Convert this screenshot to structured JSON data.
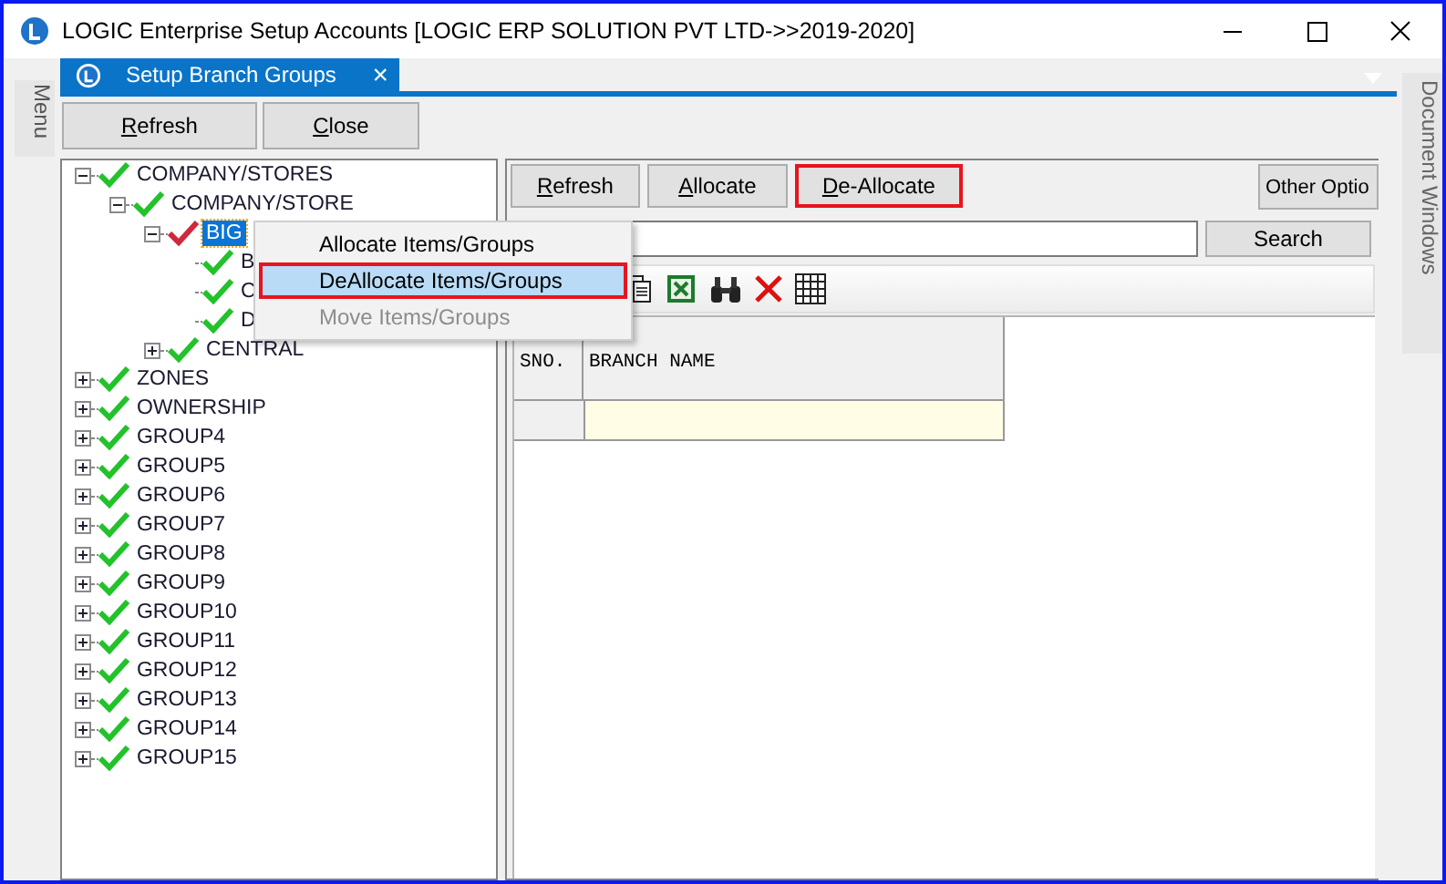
{
  "window": {
    "title": "LOGIC Enterprise Setup Accounts  [LOGIC ERP SOLUTION PVT LTD->>2019-2020]"
  },
  "side_left": {
    "label": "Menu"
  },
  "side_right": {
    "label": "Document Windows"
  },
  "tabs": [
    {
      "label": "Setup Branch Groups",
      "selected": true,
      "close": "×"
    }
  ],
  "top_buttons": [
    {
      "label": "Refresh"
    },
    {
      "label": "Close"
    }
  ],
  "tree": [
    {
      "label": "COMPANY/STORES",
      "expanded": true,
      "partial": false,
      "selected": false,
      "children": [
        {
          "label": "COMPANY/STORE",
          "expanded": true,
          "partial": false,
          "selected": false,
          "children": [
            {
              "label": "BIG",
              "expanded": true,
              "partial": true,
              "selected": true,
              "children": [
                {
                  "label": "B",
                  "partial": false,
                  "selected": false
                },
                {
                  "label": "C",
                  "partial": false,
                  "selected": false
                },
                {
                  "label": "D",
                  "partial": false,
                  "selected": false
                }
              ]
            },
            {
              "label": "CENTRAL",
              "expanded": false,
              "partial": false,
              "selected": false
            }
          ]
        }
      ]
    },
    {
      "label": "ZONES",
      "expanded": false,
      "partial": false,
      "selected": false
    },
    {
      "label": "OWNERSHIP",
      "expanded": false,
      "partial": false,
      "selected": false
    },
    {
      "label": "GROUP4",
      "expanded": false,
      "partial": false,
      "selected": false
    },
    {
      "label": "GROUP5",
      "expanded": false,
      "partial": false,
      "selected": false
    },
    {
      "label": "GROUP6",
      "expanded": false,
      "partial": false,
      "selected": false
    },
    {
      "label": "GROUP7",
      "expanded": false,
      "partial": false,
      "selected": false
    },
    {
      "label": "GROUP8",
      "expanded": false,
      "partial": false,
      "selected": false
    },
    {
      "label": "GROUP9",
      "expanded": false,
      "partial": false,
      "selected": false
    },
    {
      "label": "GROUP10",
      "expanded": false,
      "partial": false,
      "selected": false
    },
    {
      "label": "GROUP11",
      "expanded": false,
      "partial": false,
      "selected": false
    },
    {
      "label": "GROUP12",
      "expanded": false,
      "partial": false,
      "selected": false
    },
    {
      "label": "GROUP13",
      "expanded": false,
      "partial": false,
      "selected": false
    },
    {
      "label": "GROUP14",
      "expanded": false,
      "partial": false,
      "selected": false
    },
    {
      "label": "GROUP15",
      "expanded": false,
      "partial": false,
      "selected": false
    }
  ],
  "context_menu": [
    {
      "label": "Allocate Items/Groups",
      "selected": false,
      "disabled": false
    },
    {
      "label": "DeAllocate Items/Groups",
      "selected": true,
      "disabled": false
    },
    {
      "label": "Move Items/Groups",
      "selected": false,
      "disabled": true
    }
  ],
  "action_buttons": [
    {
      "label": "Refresh",
      "highlighted": false
    },
    {
      "label": "Allocate",
      "highlighted": false
    },
    {
      "label": "De-Allocate",
      "highlighted": true
    }
  ],
  "other_button": {
    "label": "Other Optio"
  },
  "search": {
    "button": "Search"
  },
  "grid": {
    "columns": [
      "SNO.",
      "BRANCH NAME"
    ]
  }
}
